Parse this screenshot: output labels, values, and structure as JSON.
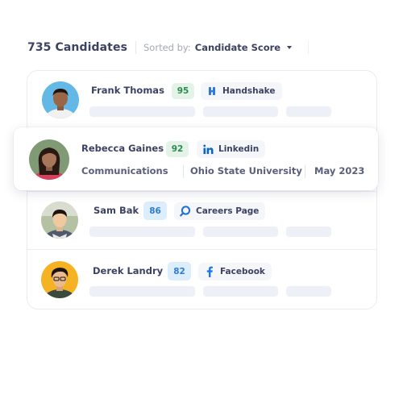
{
  "header": {
    "candidate_count": "735 Candidates",
    "sort_label": "Sorted by:",
    "sort_value": "Candidate Score"
  },
  "candidates": [
    {
      "name": "Frank Thomas",
      "score": "95",
      "source": "Handshake",
      "source_icon": "handshake-icon",
      "score_color": "#2e8a4e"
    },
    {
      "name": "Rebecca Gaines",
      "score": "92",
      "source": "Linkedin",
      "source_icon": "linkedin-icon",
      "score_color": "#2e8a4e",
      "major": "Communications",
      "school": "Ohio State University",
      "graduation": "May 2023"
    },
    {
      "name": "Sam Bak",
      "score": "86",
      "source": "Careers Page",
      "source_icon": "search-icon",
      "score_color": "#2e7bd6"
    },
    {
      "name": "Derek Landry",
      "score": "82",
      "source": "Facebook",
      "source_icon": "facebook-icon",
      "score_color": "#2e7bd6"
    }
  ],
  "colors": {
    "text": "#3c4262",
    "muted": "#a4a8b8",
    "placeholder": "#eef0f7",
    "linkedin": "#0a66c2",
    "facebook": "#1877f2",
    "handshake": "#2e7bd6"
  }
}
